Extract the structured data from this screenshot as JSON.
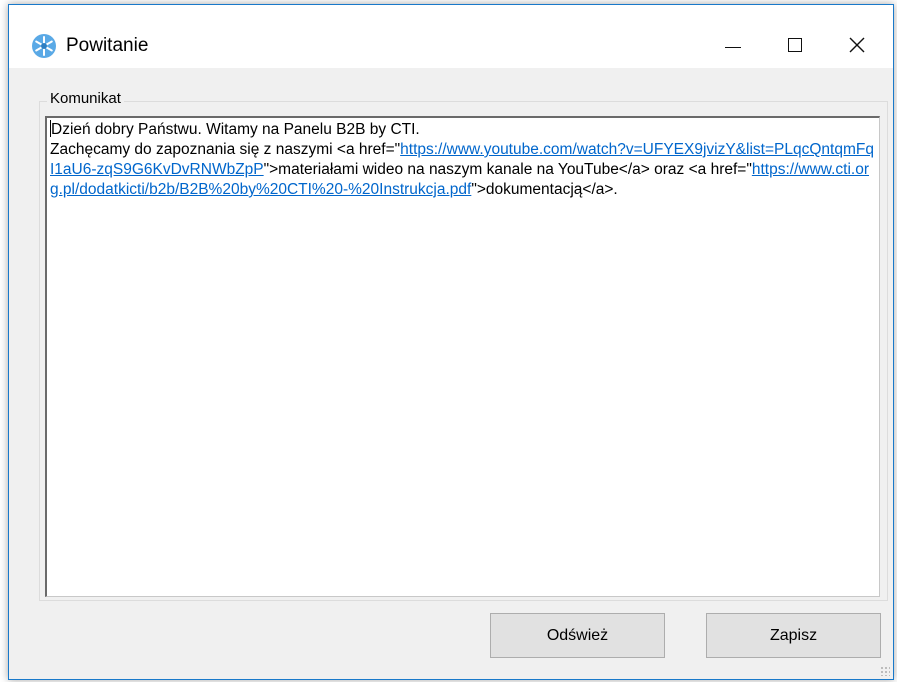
{
  "window": {
    "title": "Powitanie",
    "app_icon": "snowflake-app-icon",
    "controls": {
      "minimize": "minimize-icon",
      "maximize": "maximize-icon",
      "close": "close-icon"
    }
  },
  "group": {
    "label": "Komunikat"
  },
  "message": {
    "line1": "Dzień dobry Państwu. Witamy na Panelu B2B by CTI.",
    "text_before_link1": "Zachęcamy do zapoznania się z naszymi <a href=\"",
    "link1": "https://www.youtube.com/watch?v=UFYEX9jvizY&list=PLqcQntqmFqI1aU6-zqS9G6KvDvRNWbZpP",
    "text_between": "\">materiałami wideo na naszym kanale na YouTube</a> oraz <a href=\"",
    "link2": "https://www.cti.org.pl/dodatkicti/b2b/B2B%20by%20CTI%20-%20Instrukcja.pdf",
    "text_after": "\">dokumentacją</a>."
  },
  "buttons": {
    "refresh": "Odśwież",
    "save": "Zapisz"
  },
  "colors": {
    "link": "#0066cc",
    "window_border": "#1979ca",
    "button_bg": "#e1e1e1"
  }
}
